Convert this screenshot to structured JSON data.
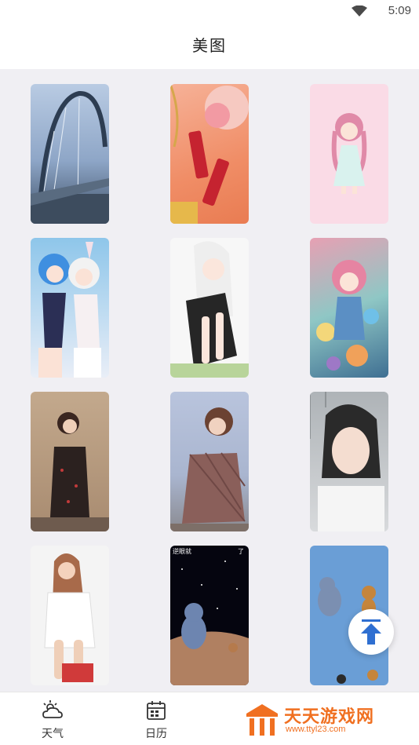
{
  "status_bar": {
    "time": "5:09",
    "wifi_icon": "wifi-icon"
  },
  "header": {
    "title": "美图"
  },
  "gallery": {
    "items": [
      {
        "name": "bridge-photo",
        "colors": [
          "#8ba3c7",
          "#35475f"
        ]
      },
      {
        "name": "lipstick-flowers-photo",
        "colors": [
          "#f0906a",
          "#f4c2b0"
        ]
      },
      {
        "name": "anime-girl-pink-photo",
        "colors": [
          "#fadbe6",
          "#f7d3df"
        ]
      },
      {
        "name": "anime-girls-bunny-photo",
        "colors": [
          "#7fb4e4",
          "#f4e8ef"
        ]
      },
      {
        "name": "anime-girl-white-hair-photo",
        "colors": [
          "#f5f5f5",
          "#2a2a2a"
        ]
      },
      {
        "name": "anime-girl-colorful-photo",
        "colors": [
          "#8fc7c5",
          "#e48aa8"
        ]
      },
      {
        "name": "woman-black-dress-photo",
        "colors": [
          "#b59a80",
          "#3a2e2a"
        ]
      },
      {
        "name": "woman-sitting-plaid-photo",
        "colors": [
          "#a9b5cf",
          "#8a6f67"
        ]
      },
      {
        "name": "woman-wet-hair-photo",
        "colors": [
          "#c4c8cb",
          "#eeeeee"
        ]
      },
      {
        "name": "woman-white-shirt-photo",
        "colors": [
          "#f3f3f3",
          "#d68b6f"
        ]
      },
      {
        "name": "tom-jerry-space-photo",
        "colors": [
          "#050510",
          "#b08061"
        ]
      },
      {
        "name": "tom-jerry-blue-photo",
        "colors": [
          "#6a9ed6",
          "#3e78c2"
        ]
      }
    ]
  },
  "fab": {
    "icon": "scroll-to-top-icon",
    "color": "#2f6fd1"
  },
  "bottom_nav": {
    "items": [
      {
        "label": "天气",
        "icon": "weather-icon"
      },
      {
        "label": "日历",
        "icon": "calendar-icon"
      }
    ]
  },
  "watermark": {
    "title": "天天游戏网",
    "url": "www.ttyl23.com",
    "color": "#f07021"
  }
}
